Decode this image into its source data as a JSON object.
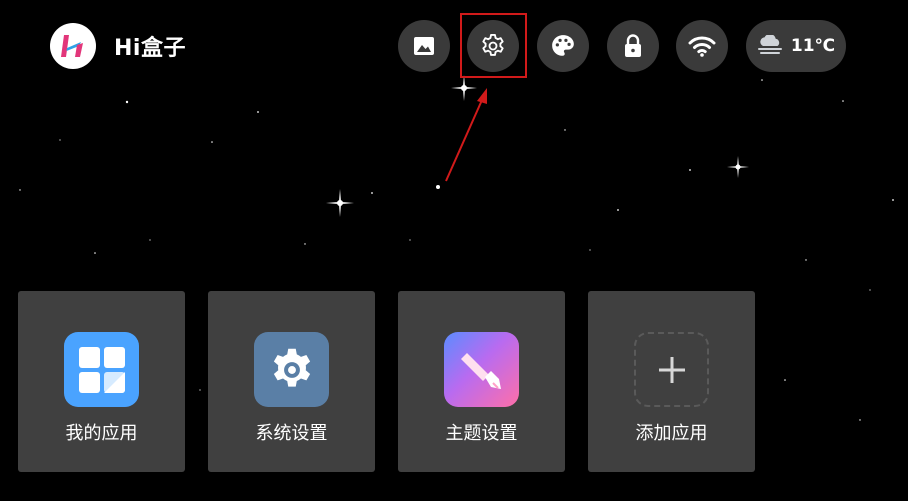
{
  "header": {
    "brand_name": "Hi盒子",
    "toolbar_icons": [
      "image-icon",
      "gear-icon",
      "palette-icon",
      "lock-icon",
      "wifi-icon"
    ],
    "weather": {
      "icon": "cloud-fog-icon",
      "temperature": "11℃"
    }
  },
  "apps": [
    {
      "label": "我的应用",
      "icon": "grid-apps-icon",
      "color": "#4aa3ff"
    },
    {
      "label": "系统设置",
      "icon": "gear-icon",
      "color": "#5a7fa6"
    },
    {
      "label": "主题设置",
      "icon": "paintbrush-icon",
      "color": "#e861b8"
    },
    {
      "label": "添加应用",
      "icon": "plus-icon",
      "color": "#404040"
    }
  ],
  "annotation": {
    "highlight_color": "#d11a1a"
  }
}
